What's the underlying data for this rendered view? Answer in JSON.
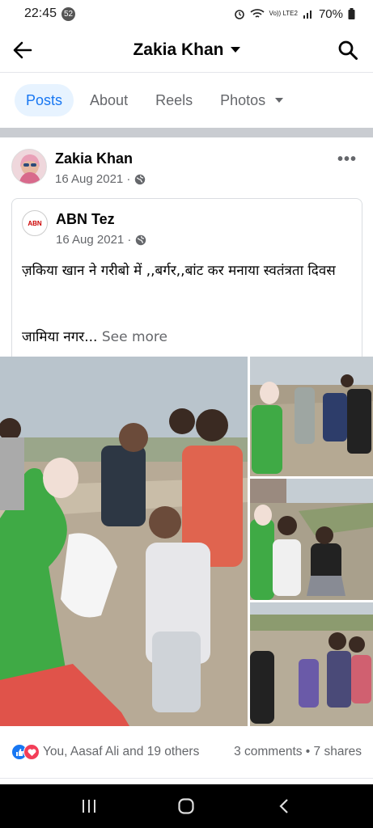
{
  "status_bar": {
    "time": "22:45",
    "notification_count": "52",
    "network_label": "Vo)) LTE2",
    "battery": "70%"
  },
  "app_bar": {
    "title": "Zakia Khan"
  },
  "tabs": [
    {
      "label": "Posts",
      "active": true
    },
    {
      "label": "About",
      "active": false
    },
    {
      "label": "Reels",
      "active": false
    },
    {
      "label": "Photos",
      "active": false
    }
  ],
  "post": {
    "author": "Zakia Khan",
    "date": "16 Aug 2021 ·",
    "more_label": "•••",
    "shared": {
      "logo_text": "ABN",
      "author": "ABN Tez",
      "date": "16 Aug 2021 ·",
      "text_line1": "ज़किया खान ने गरीबो में ,,बर्गर,,बांट कर मनाया स्वतंत्रता दिवस",
      "text_line2": "जामिया नगर...",
      "see_more": " See more"
    },
    "reactions": {
      "summary": "You, Aasaf Ali and 19 others",
      "comments": "3 comments",
      "shares": "7 shares",
      "stats_separator": " • "
    }
  },
  "icons": {
    "back": "arrow-left-icon",
    "search": "search-icon",
    "globe": "globe-icon",
    "like": "like-reaction-icon",
    "love": "love-reaction-icon"
  },
  "colors": {
    "accent": "#1877f2",
    "active_tab_bg": "#e7f3ff",
    "secondary_text": "#65676b",
    "separator": "#c9ccd1",
    "love": "#f33e58"
  }
}
